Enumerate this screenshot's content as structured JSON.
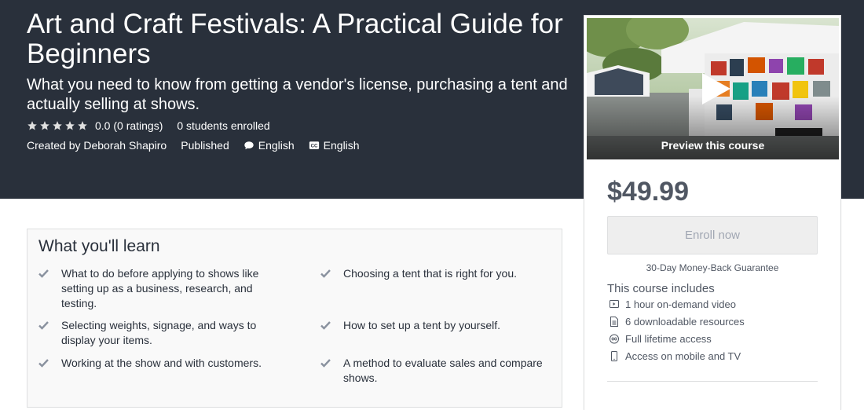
{
  "course": {
    "title": "Art and Craft Festivals: A Practical Guide for Beginners",
    "subtitle": "What you need to know from getting a vendor's license, purchasing a tent and actually selling at shows.",
    "rating_text": "0.0 (0 ratings)",
    "rating_stars": 0,
    "students": "0 students enrolled",
    "created_by": "Created by Deborah Shapiro",
    "status": "Published",
    "language": "English",
    "captions": "English"
  },
  "learn": {
    "title": "What you'll learn",
    "items": [
      "What to do before applying to shows like setting up as a business, research, and testing.",
      "Choosing a tent that is right for you.",
      "Selecting weights, signage, and ways to display your items.",
      "How to set up a tent by yourself.",
      "Working at the show and with customers.",
      "A method to evaluate sales and compare shows."
    ]
  },
  "sidebar": {
    "preview_label": "Preview this course",
    "price": "$49.99",
    "enroll_label": "Enroll now",
    "guarantee": "30-Day Money-Back Guarantee",
    "includes_title": "This course includes",
    "includes": [
      {
        "icon": "video-icon",
        "text": "1 hour on-demand video"
      },
      {
        "icon": "document-icon",
        "text": "6 downloadable resources"
      },
      {
        "icon": "infinity-icon",
        "text": "Full lifetime access"
      },
      {
        "icon": "mobile-icon",
        "text": "Access on mobile and TV"
      }
    ]
  },
  "colors": {
    "hero_bg": "#29303b",
    "star": "#e0e0e0",
    "check": "#8a929f"
  }
}
